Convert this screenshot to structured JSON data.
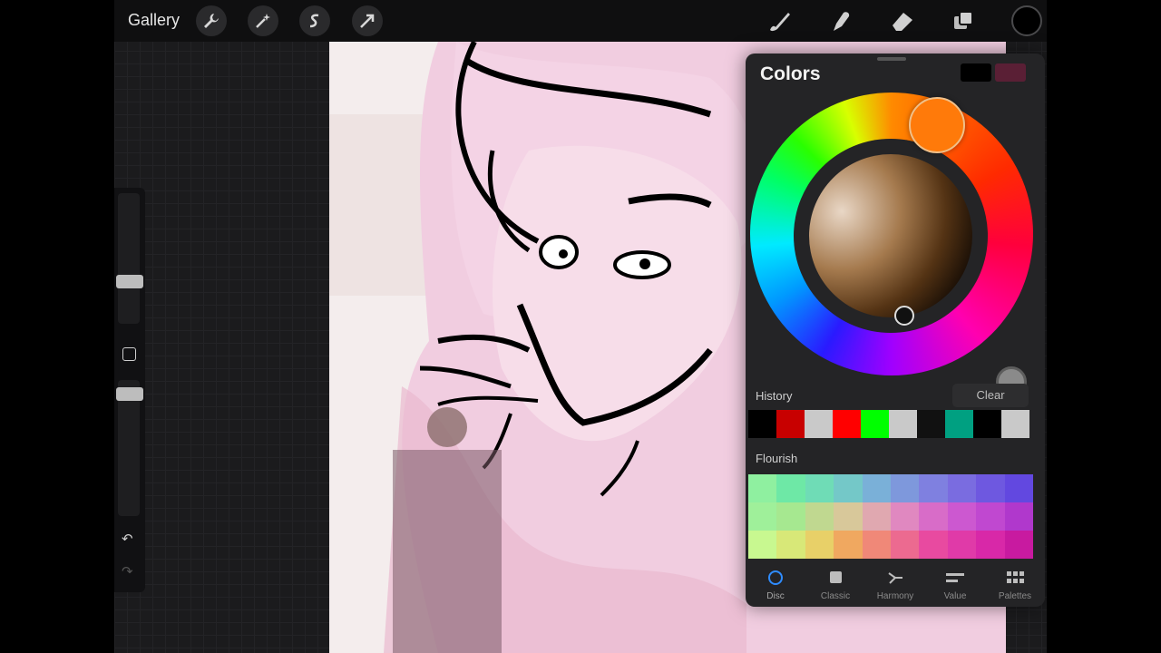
{
  "topbar": {
    "gallery_label": "Gallery",
    "tools_left": [
      "wrench-icon",
      "magic-wand-icon",
      "selection-icon",
      "transform-arrow-icon"
    ],
    "tools_right": [
      "brush-icon",
      "smudge-icon",
      "eraser-icon",
      "layers-icon"
    ],
    "current_color": "#000000"
  },
  "colors_panel": {
    "title": "Colors",
    "primary_swatch": "#000000",
    "secondary_swatch": "#5a1f35",
    "history_label": "History",
    "clear_label": "Clear",
    "history": [
      "#000000",
      "#c80000",
      "#c9c9c9",
      "#ff0000",
      "#00ff00",
      "#c9c9c9",
      "#111111",
      "#00a081",
      "#000000",
      "#c9c9c9"
    ],
    "flourish_label": "Flourish",
    "flourish": [
      [
        "#8ff0a0",
        "#6ee8a6",
        "#6fdcb6",
        "#74c8c8",
        "#7ab0d8",
        "#7e98dc",
        "#7f80e0",
        "#7a6ce0",
        "#6e58e0",
        "#6248e0"
      ],
      [
        "#9ff09a",
        "#a6e890",
        "#c0d890",
        "#d8c89a",
        "#e0a8b0",
        "#e088c0",
        "#d86cc8",
        "#cc58d0",
        "#c048d0",
        "#b038cc"
      ],
      [
        "#c8f890",
        "#d8e878",
        "#e8d068",
        "#f0a860",
        "#f08878",
        "#ec6a90",
        "#e84aa0",
        "#e03aa8",
        "#d828a8",
        "#c81aa0"
      ]
    ],
    "tabs": [
      {
        "label": "Disc",
        "icon": "disc-icon",
        "active": true
      },
      {
        "label": "Classic",
        "icon": "classic-square-icon",
        "active": false
      },
      {
        "label": "Harmony",
        "icon": "harmony-icon",
        "active": false
      },
      {
        "label": "Value",
        "icon": "value-sliders-icon",
        "active": false
      },
      {
        "label": "Palettes",
        "icon": "palettes-grid-icon",
        "active": false
      }
    ]
  }
}
